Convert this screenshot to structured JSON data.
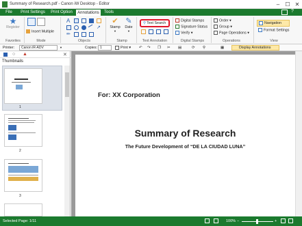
{
  "window": {
    "title": "Summary of Research.pdf - Canon iW Desktop - Editor"
  },
  "tabs": [
    "File",
    "Print Settings",
    "Print Option",
    "Annotations",
    "Tools"
  ],
  "ribbon": {
    "register": "Register",
    "insert_multiple": "Insert Multiple",
    "stamp": "Stamp",
    "date": "Date",
    "text_search": "Text Search",
    "digital_stamps": "Digital Stamps",
    "signature_status": "Signature Status",
    "verify": "Verify",
    "order": "Order",
    "group": "Group",
    "page_operations": "Page Operations",
    "navigation": "Navigation",
    "format_settings": "Format Settings",
    "groups": {
      "favorites": "Favorites",
      "mode": "Mode",
      "objects": "Objects",
      "stamp": "Stamp",
      "text_annotation": "Text Annotation",
      "digital_stamps": "Digital Stamps",
      "operations": "Operations",
      "view": "View"
    }
  },
  "toolbar": {
    "printer_label": "Printer:",
    "printer_value": "Canon iR-ADV",
    "copies_label": "Copies:",
    "copies_value": "1",
    "print": "Print",
    "display_annotations": "Display Annotations"
  },
  "left": {
    "title": "Thumbnails",
    "pages": [
      "1",
      "2",
      "3"
    ]
  },
  "document": {
    "for_line": "For: XX Corporation",
    "heading": "Summary of Research",
    "subheading": "The Future Development of “DE LA CIUDAD LUNA”"
  },
  "status": {
    "selected": "Selected Page: 1/11",
    "zoom": "100%"
  }
}
